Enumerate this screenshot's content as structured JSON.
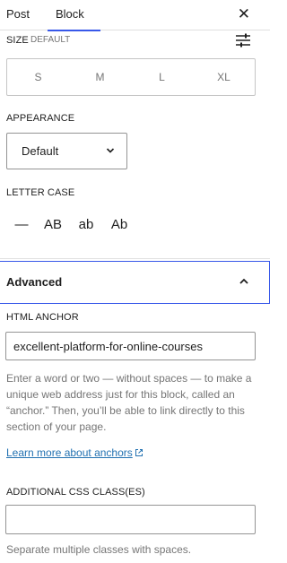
{
  "tabs": [
    {
      "label": "Post"
    },
    {
      "label": "Block"
    }
  ],
  "header": {
    "close_icon": "close-icon"
  },
  "size": {
    "label": "SIZE",
    "current": "DEFAULT",
    "options": [
      "S",
      "M",
      "L",
      "XL"
    ],
    "settings_icon": "sliders-icon"
  },
  "appearance": {
    "label": "APPEARANCE",
    "value": "Default",
    "icon": "chevron-down-icon"
  },
  "letter_case": {
    "label": "LETTER CASE",
    "options": [
      "—",
      "AB",
      "ab",
      "Ab"
    ]
  },
  "advanced": {
    "title": "Advanced",
    "icon": "chevron-up-icon",
    "html_anchor": {
      "label": "HTML ANCHOR",
      "value": "excellent-platform-for-online-courses",
      "help": "Enter a word or two — without spaces — to make a unique web address just for this block, called an “anchor.” Then, you’ll be able to link directly to this section of your page.",
      "link": "Learn more about anchors",
      "link_icon": "external-link-icon"
    },
    "css_classes": {
      "label": "ADDITIONAL CSS CLASS(ES)",
      "value": "",
      "help": "Separate multiple classes with spaces."
    }
  },
  "colors": {
    "accent": "#3858e9",
    "link": "#2271b1",
    "muted": "#757575",
    "border": "#949494"
  }
}
